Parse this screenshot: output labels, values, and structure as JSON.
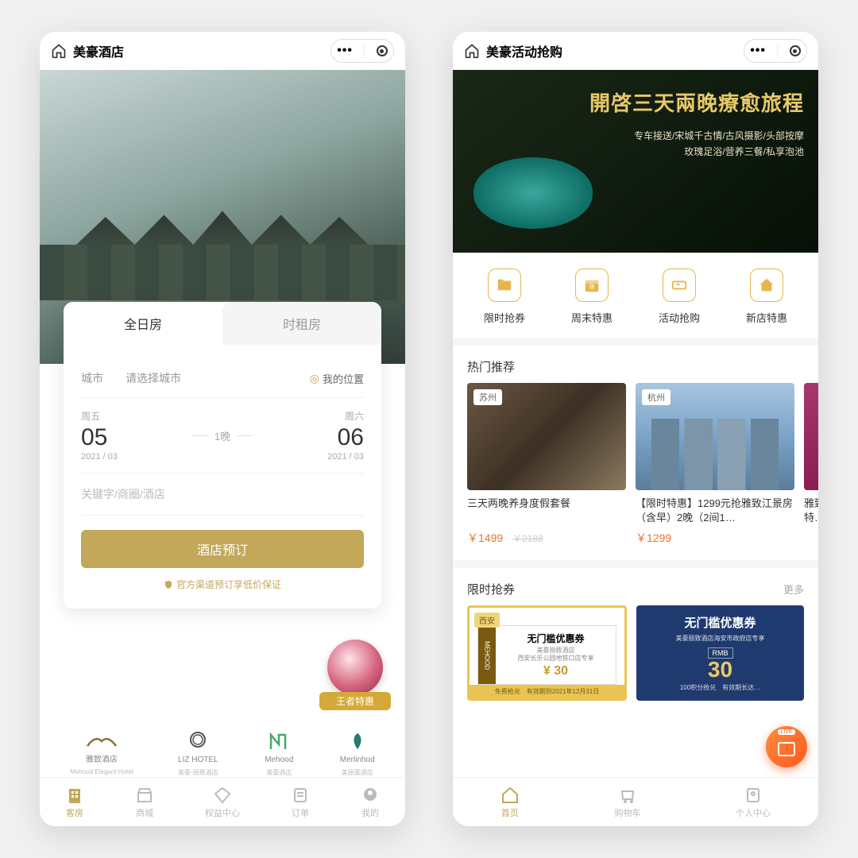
{
  "left": {
    "title": "美豪酒店",
    "tabs": {
      "full_day": "全日房",
      "hourly": "时租房"
    },
    "city_label": "城市",
    "city_placeholder": "请选择城市",
    "my_location": "我的位置",
    "checkin": {
      "dow": "周五",
      "day": "05",
      "ym": "2021 / 03"
    },
    "checkout": {
      "dow": "周六",
      "day": "06",
      "ym": "2021 / 03"
    },
    "nights": "1晚",
    "keyword_placeholder": "关键字/商圈/酒店",
    "book_btn": "酒店预订",
    "guarantee": "官方渠道预订享低价保证",
    "decor_badge": "王者特惠",
    "brands": [
      {
        "name": "雅致酒店",
        "sub": "Mehood Elegant Hotel"
      },
      {
        "name": "LIZ HOTEL",
        "sub": "美豪·丽致酒店"
      },
      {
        "name": "Mehood",
        "sub": "美豪酒店"
      },
      {
        "name": "Merlinhod",
        "sub": "美丽豪酒店"
      }
    ],
    "tabbar": [
      "客房",
      "商城",
      "权益中心",
      "订单",
      "我的"
    ]
  },
  "right": {
    "title": "美豪活动抢购",
    "hero_title": "開啓三天兩晚療愈旅程",
    "hero_line1": "专车接送/宋城千古情/古风摄影/头部按摩",
    "hero_line2": "玫瑰足浴/营养三餐/私享泡池",
    "quick": [
      "限时抢券",
      "周末特惠",
      "活动抢购",
      "新店特惠"
    ],
    "sec_hot": "热门推荐",
    "products": [
      {
        "tag": "苏州",
        "name": "三天两晚养身度假套餐",
        "price": "￥1499",
        "old": "￥2188"
      },
      {
        "tag": "杭州",
        "name": "【限时特惠】1299元抢雅致江景房（含早）2晚（2间1…",
        "price": "￥1299",
        "old": ""
      },
      {
        "tag": "",
        "name": "雅致时特…",
        "price": "",
        "old": ""
      }
    ],
    "sec_coupon": "限时抢券",
    "more": "更多",
    "coupon_y": {
      "tag": "西安",
      "brand": "MEHOOD",
      "title": "无门槛优惠券",
      "desc": "美豪丽致酒店\n西安长乐公园地铁口店专享",
      "value": "¥ 30",
      "foot": "免费抢兑　有效期到2021年12月31日"
    },
    "coupon_b": {
      "title": "无门槛优惠券",
      "desc": "美豪丽致酒店海安市政府店专享",
      "rmb": "RMB",
      "value": "30",
      "foot": "100积分抢兑　有效期长达…"
    },
    "fab": "LIVE",
    "tabbar": [
      "首页",
      "购物车",
      "个人中心"
    ]
  }
}
